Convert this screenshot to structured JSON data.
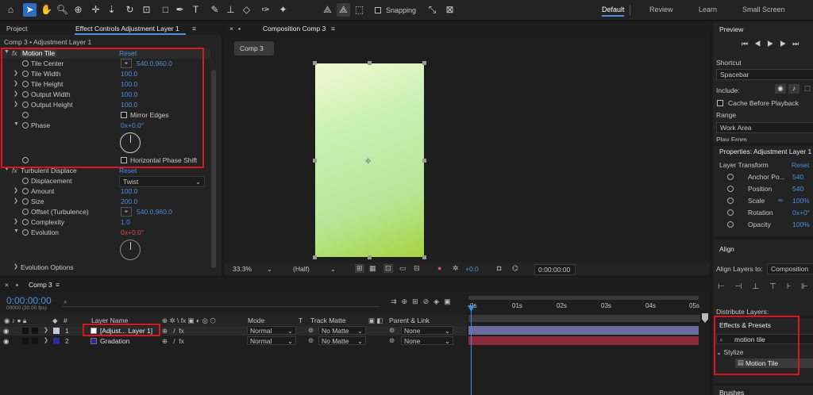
{
  "toolbar": {
    "snapping_label": "Snapping",
    "workspaces": [
      "Default",
      "Review",
      "Learn",
      "Small Screen"
    ]
  },
  "left_panel": {
    "tab_project": "Project",
    "tab_effect_controls": "Effect Controls Adjustment Layer 1",
    "breadcrumb": "Comp 3 • Adjustment Layer 1",
    "effect1": {
      "name": "Motion Tile",
      "reset": "Reset",
      "props": [
        {
          "label": "Tile Center",
          "value": "540.0,960.0"
        },
        {
          "label": "Tile Width",
          "value": "100.0"
        },
        {
          "label": "Tile Height",
          "value": "100.0"
        },
        {
          "label": "Output Width",
          "value": "100.0"
        },
        {
          "label": "Output Height",
          "value": "100.0"
        }
      ],
      "mirror_edges": "Mirror Edges",
      "phase_label": "Phase",
      "phase_value": "0x+0.0°",
      "horizontal_phase_shift": "Horizontal Phase Shift"
    },
    "effect2": {
      "name": "Turbulent Displace",
      "reset": "Reset",
      "displacement_label": "Displacement",
      "displacement_value": "Twist",
      "amount_label": "Amount",
      "amount_value": "100.0",
      "size_label": "Size",
      "size_value": "200.0",
      "offset_label": "Offset (Turbulence)",
      "offset_value": "540.0,960.0",
      "complexity_label": "Complexity",
      "complexity_value": "1.0",
      "evolution_label": "Evolution",
      "evolution_value": "0x+0.0°",
      "evolution_options": "Evolution Options"
    }
  },
  "composition": {
    "tab_title": "Composition Comp 3",
    "comp_tab": "Comp 3",
    "zoom": "33.3%",
    "resolution": "(Half)",
    "exposure": "+0.0",
    "timecode": "0:00:00:00"
  },
  "right_panel": {
    "preview_title": "Preview",
    "shortcut_label": "Shortcut",
    "shortcut_value": "Spacebar",
    "include_label": "Include:",
    "cache_label": "Cache Before Playback",
    "range_label": "Range",
    "range_value": "Work Area",
    "play_from_label": "Play From",
    "properties_title": "Properties: Adjustment Layer 1",
    "layer_transform": "Layer Transform",
    "reset": "Reset",
    "transform": [
      {
        "label": "Anchor Po...",
        "value": "540"
      },
      {
        "label": "Position",
        "value": "540"
      },
      {
        "label": "Scale",
        "value": "100%"
      },
      {
        "label": "Rotation",
        "value": "0x+0°"
      },
      {
        "label": "Opacity",
        "value": "100%"
      }
    ],
    "align_title": "Align",
    "align_layers_to": "Align Layers to:",
    "align_target": "Composition",
    "distribute_layers": "Distribute Layers:",
    "effects_presets_title": "Effects & Presets",
    "search_value": "motion tile",
    "category": "Stylize",
    "result": "Motion Tile",
    "brushes": "Brushes"
  },
  "timeline": {
    "tab": "Comp 3",
    "timecode": "0:00:00:00",
    "frame_info": "00000 (30.00 fps)",
    "col_layer_name": "Layer Name",
    "col_mode": "Mode",
    "col_t": "T",
    "col_track_matte": "Track Matte",
    "col_parent": "Parent & Link",
    "ruler": [
      "0s",
      "01s",
      "02s",
      "03s",
      "04s",
      "05s"
    ],
    "layers": [
      {
        "num": "1",
        "name": "[Adjust... Layer 1]",
        "mode": "Normal",
        "matte": "No Matte",
        "parent": "None",
        "color": "#c8c8e0"
      },
      {
        "num": "2",
        "name": "Gradation",
        "mode": "Normal",
        "matte": "No Matte",
        "parent": "None",
        "color": "#2a2a9a"
      }
    ]
  },
  "colors": {
    "accent": "#2d6ec4",
    "value_blue": "#4a8fe0",
    "highlight_red": "#e0141a",
    "playhead": "#3a8ee6"
  }
}
